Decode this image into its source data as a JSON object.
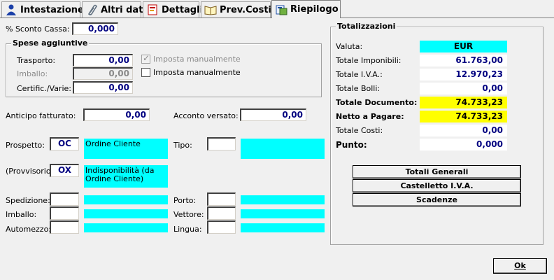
{
  "tabs": [
    {
      "label": "Intestazione",
      "icon": "person-icon",
      "mnemonic": "I"
    },
    {
      "label": "Altri dati",
      "icon": "paperclip-icon",
      "mnemonic": "A"
    },
    {
      "label": "Dettagli",
      "icon": "document-icon",
      "mnemonic": "D"
    },
    {
      "label": "Prev.Costi",
      "icon": "book-icon",
      "mnemonic": "C"
    },
    {
      "label": "Riepilogo",
      "icon": "summary-icon",
      "mnemonic": "R",
      "active": true
    }
  ],
  "sconto_cassa": {
    "label": "% Sconto Cassa:",
    "value": "0,000"
  },
  "spese": {
    "title": "Spese aggiuntive",
    "trasporto": {
      "label": "Trasporto:",
      "value": "0,00"
    },
    "imballo": {
      "label": "Imballo:",
      "value": "0,00"
    },
    "certific": {
      "label": "Certific./Varie:",
      "value": "0,00"
    },
    "imposta1": {
      "label": "Imposta manualmente",
      "checked": true,
      "disabled": true
    },
    "imposta2": {
      "label": "Imposta manualmente",
      "checked": false
    }
  },
  "anticipo": {
    "label": "Anticipo fatturato:",
    "value": "0,00"
  },
  "acconto": {
    "label": "Acconto versato:",
    "value": "0,00"
  },
  "prospetto": {
    "label": "Prospetto:",
    "code": "OC",
    "desc": "Ordine Cliente"
  },
  "tipo": {
    "label": "Tipo:",
    "code": "",
    "desc": ""
  },
  "provvisorio": {
    "label": "(Provvisorio):",
    "code": "OX",
    "desc": "Indisponibilità (da Ordine Cliente)"
  },
  "spedizione": {
    "label": "Spedizione:",
    "code": "",
    "desc": ""
  },
  "porto": {
    "label": "Porto:",
    "code": "",
    "desc": ""
  },
  "imballo2": {
    "label": "Imballo:",
    "code": "",
    "desc": ""
  },
  "vettore": {
    "label": "Vettore:",
    "code": "",
    "desc": ""
  },
  "automezzo": {
    "label": "Automezzo:",
    "code": "",
    "desc": ""
  },
  "lingua": {
    "label": "Lingua:",
    "code": "",
    "desc": ""
  },
  "totali": {
    "title": "Totalizzazioni",
    "valuta": {
      "label": "Valuta:",
      "value": "EUR"
    },
    "imponibili": {
      "label": "Totale Imponibili:",
      "value": "61.763,00"
    },
    "iva": {
      "label": "Totale I.V.A.:",
      "value": "12.970,23"
    },
    "bolli": {
      "label": "Totale Bolli:",
      "value": "0,00"
    },
    "documento": {
      "label": "Totale Documento:",
      "value": "74.733,23"
    },
    "netto": {
      "label": "Netto a Pagare:",
      "value": "74.733,23"
    },
    "costi": {
      "label": "Totale Costi:",
      "value": "0,00"
    },
    "punto": {
      "label": "Punto:",
      "value": "0,000"
    }
  },
  "buttons": {
    "totali_generali": "Totali Generali",
    "castelletto": "Castelletto I.V.A.",
    "scadenze": "Scadenze",
    "ok": "Ok"
  },
  "colors": {
    "cyan": "#00ffff",
    "yellow": "#ffff00",
    "value_text": "#000080"
  }
}
